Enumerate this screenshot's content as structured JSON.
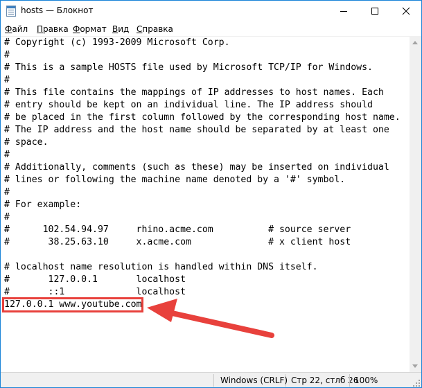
{
  "window": {
    "title": "hosts — Блокнот",
    "icon": "notepad-icon",
    "controls": [
      "minimize-icon",
      "maximize-icon",
      "close-icon"
    ]
  },
  "menu": [
    {
      "name": "menu-file",
      "label": "Файл"
    },
    {
      "name": "menu-edit",
      "label": "Правка"
    },
    {
      "name": "menu-format",
      "label": "Формат"
    },
    {
      "name": "menu-view",
      "label": "Вид"
    },
    {
      "name": "menu-help",
      "label": "Справка"
    }
  ],
  "editor": {
    "lines": [
      "# Copyright (c) 1993-2009 Microsoft Corp.",
      "#",
      "# This is a sample HOSTS file used by Microsoft TCP/IP for Windows.",
      "#",
      "# This file contains the mappings of IP addresses to host names. Each",
      "# entry should be kept on an individual line. The IP address should",
      "# be placed in the first column followed by the corresponding host name.",
      "# The IP address and the host name should be separated by at least one",
      "# space.",
      "#",
      "# Additionally, comments (such as these) may be inserted on individual",
      "# lines or following the machine name denoted by a '#' symbol.",
      "#",
      "# For example:",
      "#",
      "#      102.54.94.97     rhino.acme.com          # source server",
      "#       38.25.63.10     x.acme.com              # x client host",
      "",
      "# localhost name resolution is handled within DNS itself.",
      "#       127.0.0.1       localhost",
      "#       ::1             localhost",
      "127.0.0.1 www.youtube.com"
    ],
    "highlighted_line": "127.0.0.1 www.youtube.com"
  },
  "status": {
    "line_ending": "Windows (CRLF)",
    "position": "Стр 22, стлб 26",
    "zoom": "100%"
  },
  "colors": {
    "accent_border": "#1883d7",
    "annotation": "#e8413c"
  }
}
